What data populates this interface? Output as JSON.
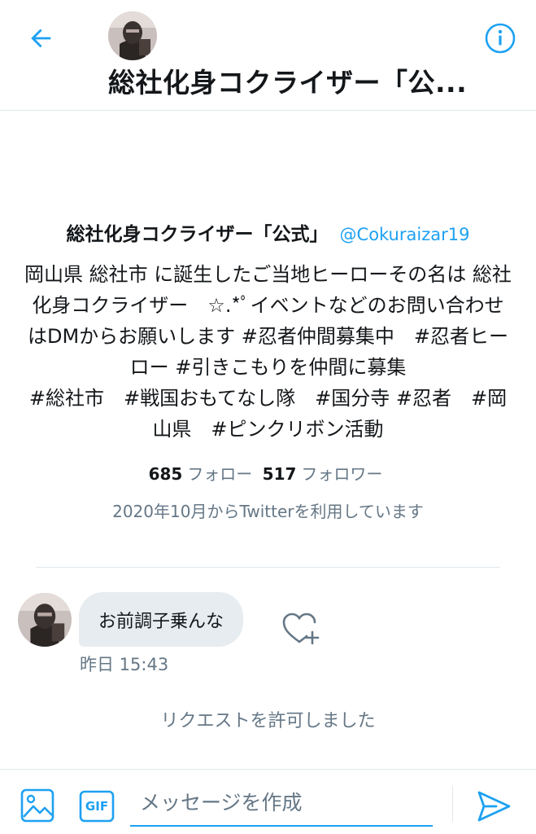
{
  "header": {
    "title": "総社化身コクライザー「公...",
    "back_icon": "arrow-left-icon",
    "info_icon": "info-icon",
    "accent": "#1da1f2"
  },
  "profile": {
    "display_name": "総社化身コクライザー「公式」",
    "handle": "@Cokuraizar19",
    "bio": "岡山県 総社市 に誕生したご当地ヒーローその名は 総社化身コクライザー　☆.*ﾟイベントなどのお問い合わせはDMからお願いします #忍者仲間募集中　#忍者ヒーロー #引きこもりを仲間に募集\n#総社市　#戦国おもてなし隊　#国分寺 #忍者　#岡山県　#ピンクリボン活動",
    "following_count": "685",
    "following_label": "フォロー",
    "followers_count": "517",
    "followers_label": "フォロワー",
    "joined": "2020年10月からTwitterを利用しています"
  },
  "message": {
    "text": "お前調子乗んな",
    "time": "昨日 15:43",
    "like_icon": "heart-plus-icon",
    "bubble_color": "#e6ecf0"
  },
  "system_note": "リクエストを許可しました",
  "composer": {
    "placeholder": "メッセージを作成",
    "photo_icon": "image-icon",
    "gif_label": "GIF",
    "send_icon": "send-icon"
  }
}
